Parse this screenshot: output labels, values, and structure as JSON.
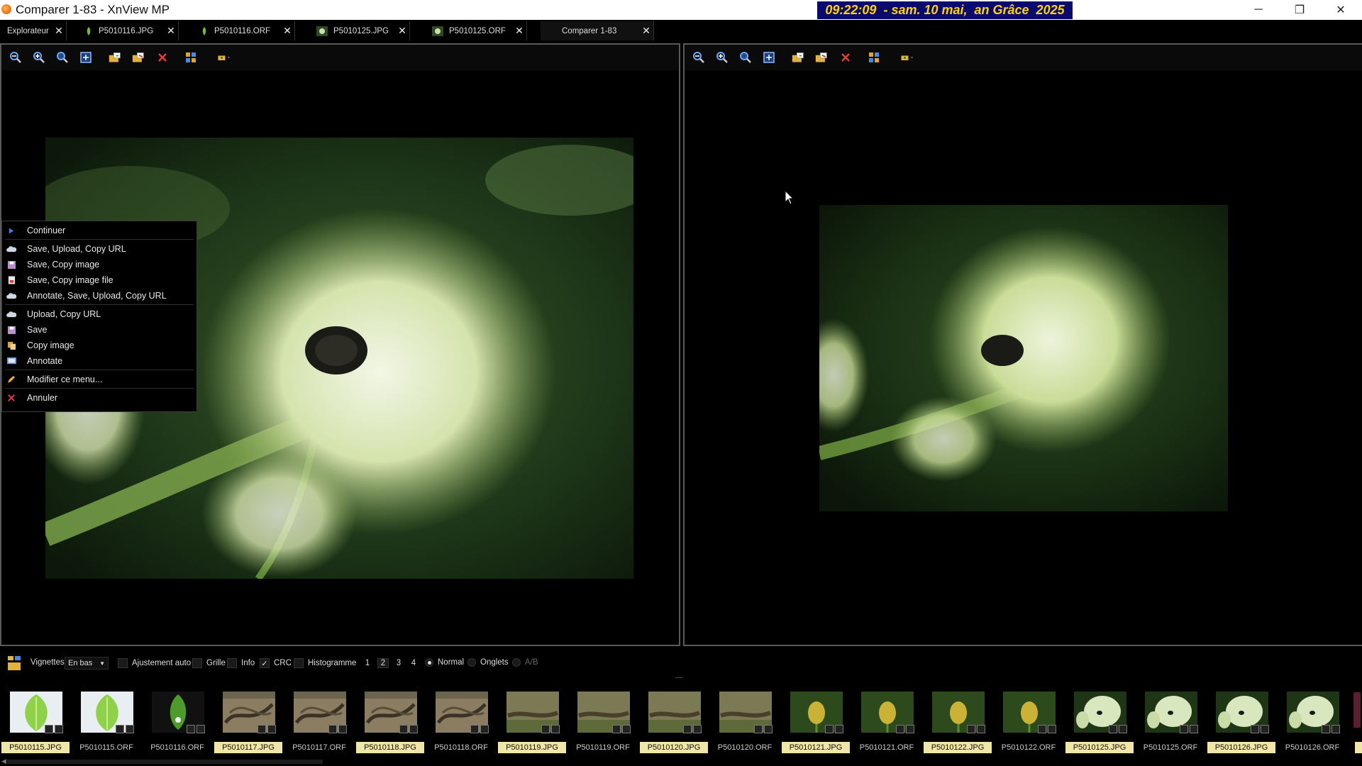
{
  "window": {
    "title": "Comparer 1-83 - XnView MP",
    "clock": "09:22:09  - sam. 10 mai,  an Grâce  2025",
    "minimize": "─",
    "restore": "❐",
    "close": "✕"
  },
  "tabs": [
    {
      "label": "Explorateur",
      "icon": "none"
    },
    {
      "label": "P5010116.JPG",
      "icon": "leaf-icon"
    },
    {
      "label": "P5010116.ORF",
      "icon": "leaf-icon"
    },
    {
      "label": "P5010125.JPG",
      "icon": "flower-icon"
    },
    {
      "label": "P5010125.ORF",
      "icon": "flower-icon"
    },
    {
      "label": "Comparer 1-83",
      "icon": "none"
    }
  ],
  "tab_close": "✕",
  "toolbar_icons": [
    "zoom-out-icon",
    "zoom-in-icon",
    "zoom-fit-icon",
    "fullscreen-icon",
    "copy-to-folder-icon",
    "move-to-folder-icon",
    "delete-icon",
    "layout-icon",
    "open-folder-icon"
  ],
  "context_menu": {
    "items": [
      {
        "label": "Continuer",
        "icon": "play-icon"
      },
      {
        "label": "Save, Upload, Copy URL",
        "icon": "cloud-icon"
      },
      {
        "label": "Save, Copy image",
        "icon": "save-icon"
      },
      {
        "label": "Save, Copy image file",
        "icon": "file-icon"
      },
      {
        "label": "Annotate, Save, Upload, Copy URL",
        "icon": "cloud-icon"
      },
      {
        "label": "Upload, Copy URL",
        "icon": "cloud-icon"
      },
      {
        "label": "Save",
        "icon": "save-icon"
      },
      {
        "label": "Copy image",
        "icon": "copy-icon"
      },
      {
        "label": "Annotate",
        "icon": "annotate-icon"
      },
      {
        "label": "Modifier ce menu...",
        "icon": "pencil-icon"
      },
      {
        "label": "Annuler",
        "icon": "cancel-icon"
      }
    ]
  },
  "bottom_bar": {
    "vignettes_label": "Vignettes",
    "position_value": "En bas",
    "ajustement_label": "Ajustement auto",
    "grille_label": "Grille",
    "info_label": "Info",
    "crc_label": "CRC",
    "crc_check": "✓",
    "histogramme_label": "Histogramme",
    "numbers": [
      "1",
      "2",
      "3",
      "4"
    ],
    "normal_label": "Normal",
    "onglets_label": "Onglets",
    "ab_label": "A/B",
    "splitter": "......"
  },
  "thumbnails": [
    {
      "label": "P5010115.JPG",
      "highlighted": true,
      "kind": "leaf-bright"
    },
    {
      "label": "P5010115.ORF",
      "highlighted": false,
      "kind": "leaf-bright"
    },
    {
      "label": "P5010116.ORF",
      "highlighted": false,
      "kind": "leaf-dark"
    },
    {
      "label": "P5010117.JPG",
      "highlighted": true,
      "kind": "lizard"
    },
    {
      "label": "P5010117.ORF",
      "highlighted": false,
      "kind": "lizard"
    },
    {
      "label": "P5010118.JPG",
      "highlighted": true,
      "kind": "lizard"
    },
    {
      "label": "P5010118.ORF",
      "highlighted": false,
      "kind": "lizard"
    },
    {
      "label": "P5010119.JPG",
      "highlighted": true,
      "kind": "lizard2"
    },
    {
      "label": "P5010119.ORF",
      "highlighted": false,
      "kind": "lizard2"
    },
    {
      "label": "P5010120.JPG",
      "highlighted": true,
      "kind": "lizard2"
    },
    {
      "label": "P5010120.ORF",
      "highlighted": false,
      "kind": "lizard2"
    },
    {
      "label": "P5010121.JPG",
      "highlighted": true,
      "kind": "bud"
    },
    {
      "label": "P5010121.ORF",
      "highlighted": false,
      "kind": "bud"
    },
    {
      "label": "P5010122.JPG",
      "highlighted": true,
      "kind": "bud"
    },
    {
      "label": "P5010122.ORF",
      "highlighted": false,
      "kind": "bud"
    },
    {
      "label": "P5010125.JPG",
      "highlighted": true,
      "kind": "flower"
    },
    {
      "label": "P5010125.ORF",
      "highlighted": false,
      "kind": "flower"
    },
    {
      "label": "P5010126.JPG",
      "highlighted": true,
      "kind": "flower"
    },
    {
      "label": "P5010126.ORF",
      "highlighted": false,
      "kind": "flower"
    }
  ],
  "colors": {
    "clock_bg": "#0a0a6e",
    "clock_fg": "#ffd400",
    "thumb_highlight": "#f0e6a8",
    "pane_border": "#5a5a5a"
  }
}
